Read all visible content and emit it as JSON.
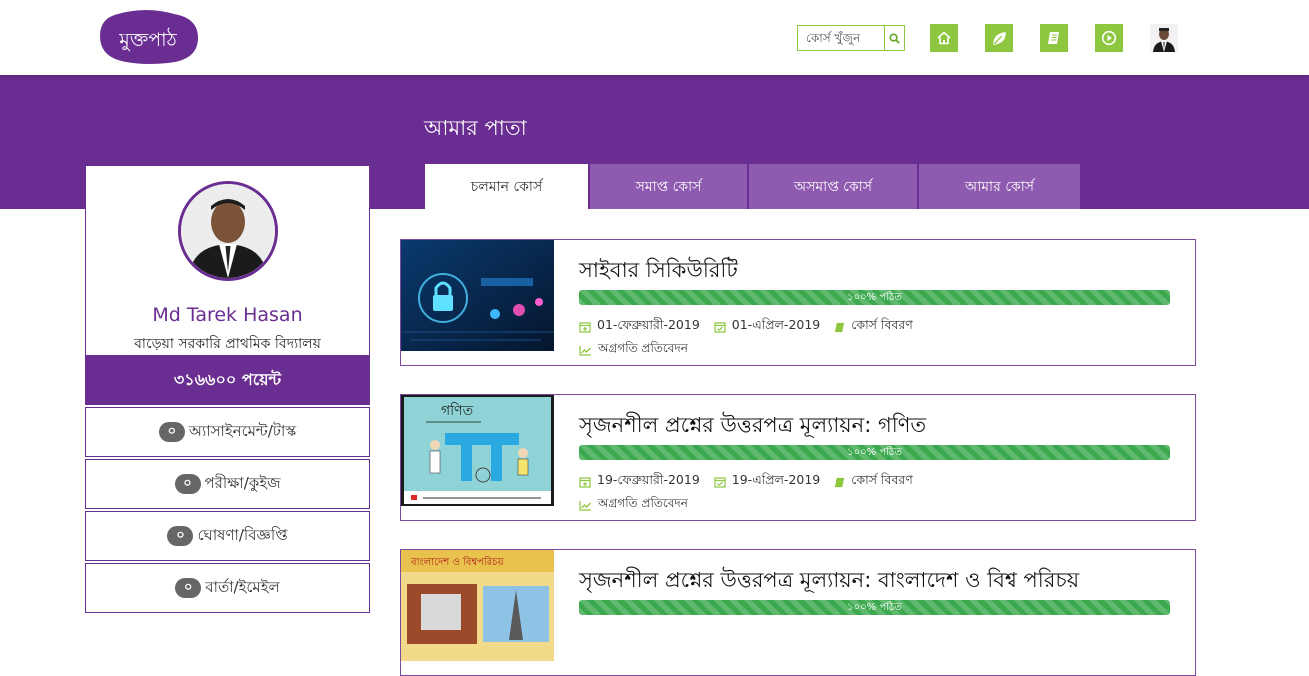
{
  "header": {
    "logo_text": "মুক্তপাঠ",
    "search_placeholder": "কোর্স খুঁজুন",
    "nav_icons": [
      "home-icon",
      "leaf-icon",
      "book-icon",
      "play-icon"
    ]
  },
  "page": {
    "title": "আমার পাতা"
  },
  "tabs": [
    {
      "label": "চলমান কোর্স",
      "active": true
    },
    {
      "label": "সমাপ্ত কোর্স",
      "active": false
    },
    {
      "label": "অসমাপ্ত কোর্স",
      "active": false
    },
    {
      "label": "আমার কোর্স",
      "active": false
    }
  ],
  "profile": {
    "name": "Md Tarek Hasan",
    "school": "বাড়েয়া সরকারি প্রাথমিক বিদ্যালয়",
    "points": "৩১৬৬০০ পয়েন্ট"
  },
  "sidebar": {
    "items": [
      {
        "count": "০",
        "label": "অ্যাসাইনমেন্ট/টাস্ক"
      },
      {
        "count": "০",
        "label": "পরীক্ষা/কুইজ"
      },
      {
        "count": "০",
        "label": "ঘোষণা/বিজ্ঞপ্তি"
      },
      {
        "count": "০",
        "label": "বার্তা/ইমেইল"
      }
    ]
  },
  "courses": [
    {
      "title": "সাইবার সিকিউরিটি",
      "progress_label": "১০০% পঠিত",
      "progress": 100,
      "start_date": "01-ফেব্রুয়ারী-2019",
      "end_date": "01-এপ্রিল-2019",
      "details_label": "কোর্স বিবরণ",
      "report_label": "অগ্রগতি প্রতিবেদন"
    },
    {
      "title": "সৃজনশীল প্রশ্নের উত্তরপত্র মূল্যায়ন: গণিত",
      "thumb_title": "গণিত",
      "progress_label": "১০০% পঠিত",
      "progress": 100,
      "start_date": "19-ফেব্রুয়ারী-2019",
      "end_date": "19-এপ্রিল-2019",
      "details_label": "কোর্স বিবরণ",
      "report_label": "অগ্রগতি প্রতিবেদন"
    },
    {
      "title": "সৃজনশীল প্রশ্নের উত্তরপত্র মূল্যায়ন: বাংলাদেশ ও বিশ্ব পরিচয়",
      "thumb_title": "বাংলাদেশ ও বিশ্বপরিচয়",
      "progress_label": "১০০% পঠিত",
      "progress": 100
    }
  ],
  "colors": {
    "brand_purple": "#6a2d91",
    "tab_inactive": "#8f5bb0",
    "accent_green": "#8dc63f",
    "progress_green": "#3ca94e"
  }
}
